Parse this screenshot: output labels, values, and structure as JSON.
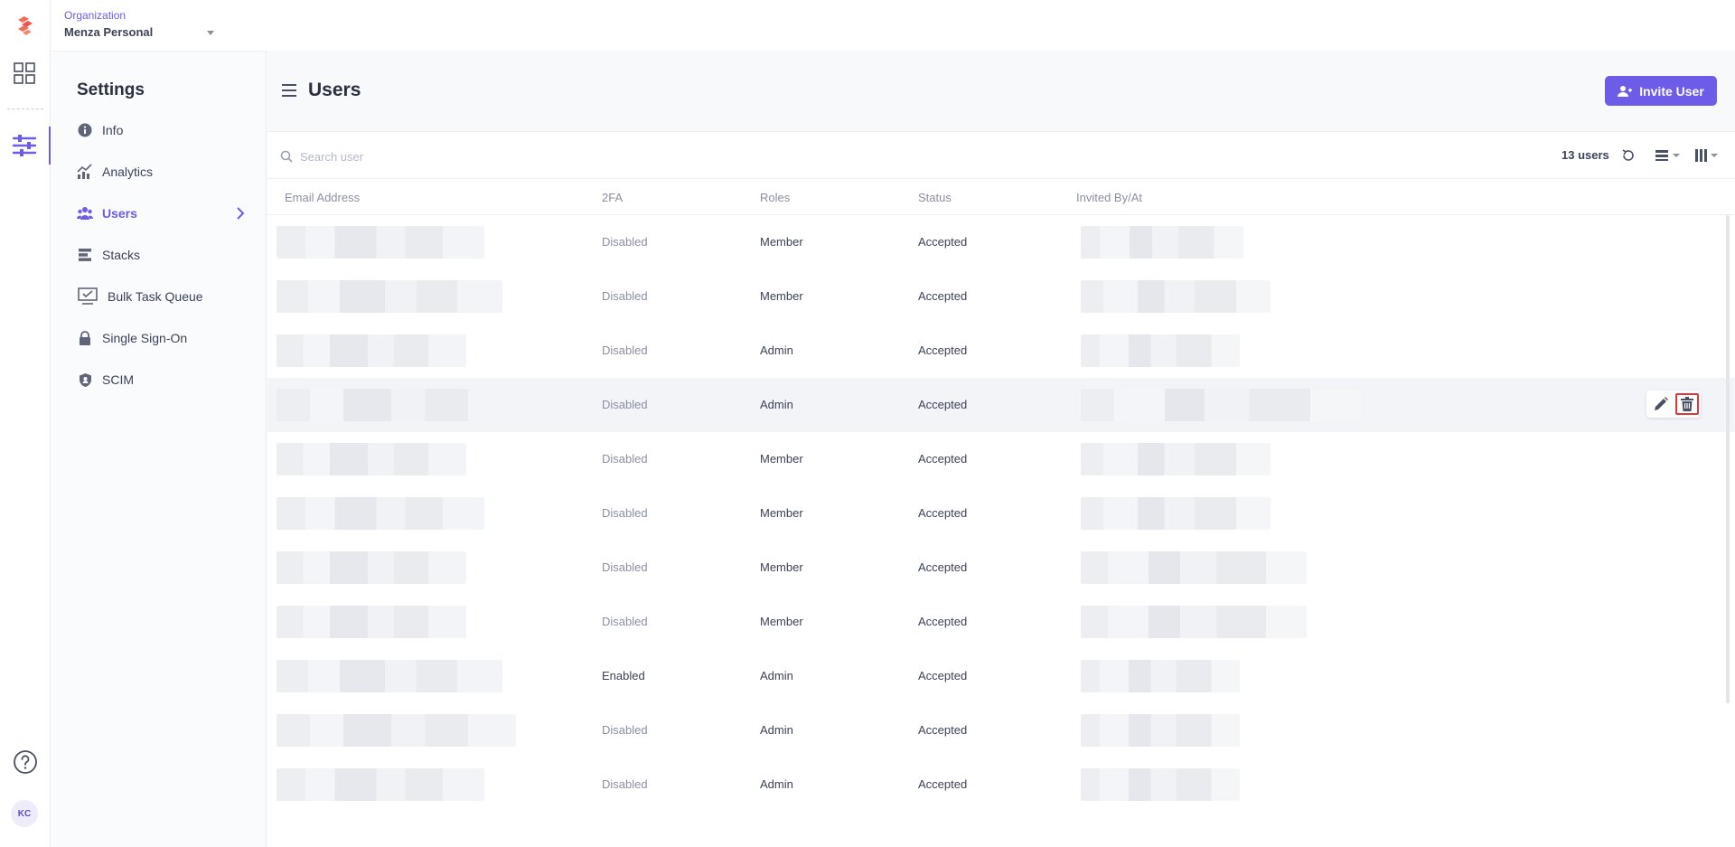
{
  "org": {
    "label": "Organization",
    "name": "Menza Personal"
  },
  "rail": {
    "avatar_initials": "KC"
  },
  "sidebar": {
    "title": "Settings",
    "items": [
      {
        "label": "Info",
        "icon": "info-icon"
      },
      {
        "label": "Analytics",
        "icon": "analytics-icon"
      },
      {
        "label": "Users",
        "icon": "users-icon",
        "active": true
      },
      {
        "label": "Stacks",
        "icon": "stacks-icon"
      },
      {
        "label": "Bulk Task Queue",
        "icon": "monitor-check-icon"
      },
      {
        "label": "Single Sign-On",
        "icon": "lock-icon"
      },
      {
        "label": "SCIM",
        "icon": "shield-icon"
      }
    ]
  },
  "header": {
    "title": "Users",
    "invite_label": "Invite User"
  },
  "toolbar": {
    "search_placeholder": "Search user",
    "user_count": "13 users"
  },
  "table": {
    "columns": [
      "Email Address",
      "2FA",
      "Roles",
      "Status",
      "Invited By/At"
    ],
    "rows": [
      {
        "twofa": "Disabled",
        "role": "Member",
        "status": "Accepted"
      },
      {
        "twofa": "Disabled",
        "role": "Member",
        "status": "Accepted"
      },
      {
        "twofa": "Disabled",
        "role": "Admin",
        "status": "Accepted"
      },
      {
        "twofa": "Disabled",
        "role": "Admin",
        "status": "Accepted"
      },
      {
        "twofa": "Disabled",
        "role": "Member",
        "status": "Accepted"
      },
      {
        "twofa": "Disabled",
        "role": "Member",
        "status": "Accepted"
      },
      {
        "twofa": "Disabled",
        "role": "Member",
        "status": "Accepted"
      },
      {
        "twofa": "Disabled",
        "role": "Member",
        "status": "Accepted"
      },
      {
        "twofa": "Enabled",
        "role": "Admin",
        "status": "Accepted"
      },
      {
        "twofa": "Disabled",
        "role": "Admin",
        "status": "Accepted"
      },
      {
        "twofa": "Disabled",
        "role": "Admin",
        "status": "Accepted"
      }
    ]
  },
  "colors": {
    "accent": "#6c5ce7",
    "highlight": "#e03838"
  }
}
